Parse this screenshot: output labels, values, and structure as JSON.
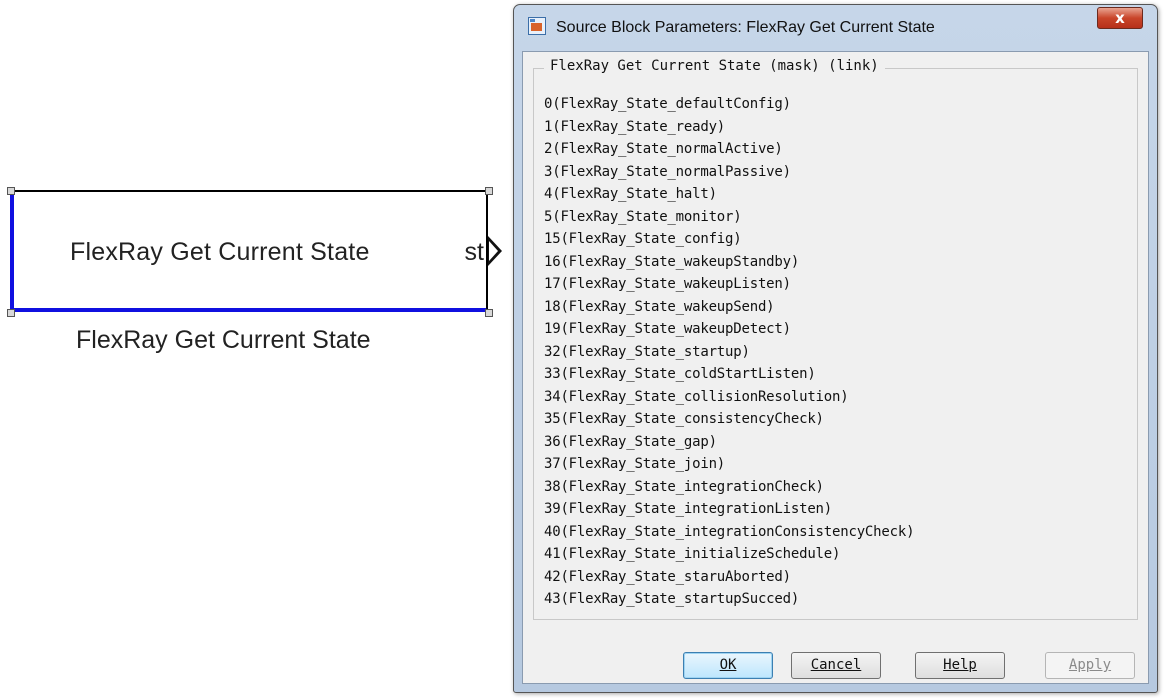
{
  "block": {
    "title": "FlexRay Get Current State",
    "port_label": "st",
    "name": "FlexRay Get Current State"
  },
  "dialog": {
    "title": "Source Block Parameters: FlexRay Get Current State",
    "close_label": "x",
    "group_title": "FlexRay Get Current State (mask) (link)",
    "description_lines": [
      "0(FlexRay_State_defaultConfig)",
      "1(FlexRay_State_ready)",
      "2(FlexRay_State_normalActive)",
      "3(FlexRay_State_normalPassive)",
      "4(FlexRay_State_halt)",
      "5(FlexRay_State_monitor)",
      "15(FlexRay_State_config)",
      "16(FlexRay_State_wakeupStandby)",
      "17(FlexRay_State_wakeupListen)",
      "18(FlexRay_State_wakeupSend)",
      "19(FlexRay_State_wakeupDetect)",
      "32(FlexRay_State_startup)",
      "33(FlexRay_State_coldStartListen)",
      "34(FlexRay_State_collisionResolution)",
      "35(FlexRay_State_consistencyCheck)",
      "36(FlexRay_State_gap)",
      "37(FlexRay_State_join)",
      "38(FlexRay_State_integrationCheck)",
      "39(FlexRay_State_integrationListen)",
      "40(FlexRay_State_integrationConsistencyCheck)",
      "41(FlexRay_State_initializeSchedule)",
      "42(FlexRay_State_staruAborted)",
      "43(FlexRay_State_startupSucced)"
    ],
    "buttons": {
      "ok": "OK",
      "cancel": "Cancel",
      "help": "Help",
      "apply": "Apply"
    }
  },
  "colors": {
    "block_highlight": "#1010e0",
    "titlebar": "#b6c9e0",
    "close_button": "#c9452a",
    "ok_button_border": "#3c7fb1"
  },
  "icons": {
    "app_icon": "simulink-icon",
    "close_icon": "close-icon",
    "port_icon": "output-port-icon"
  }
}
